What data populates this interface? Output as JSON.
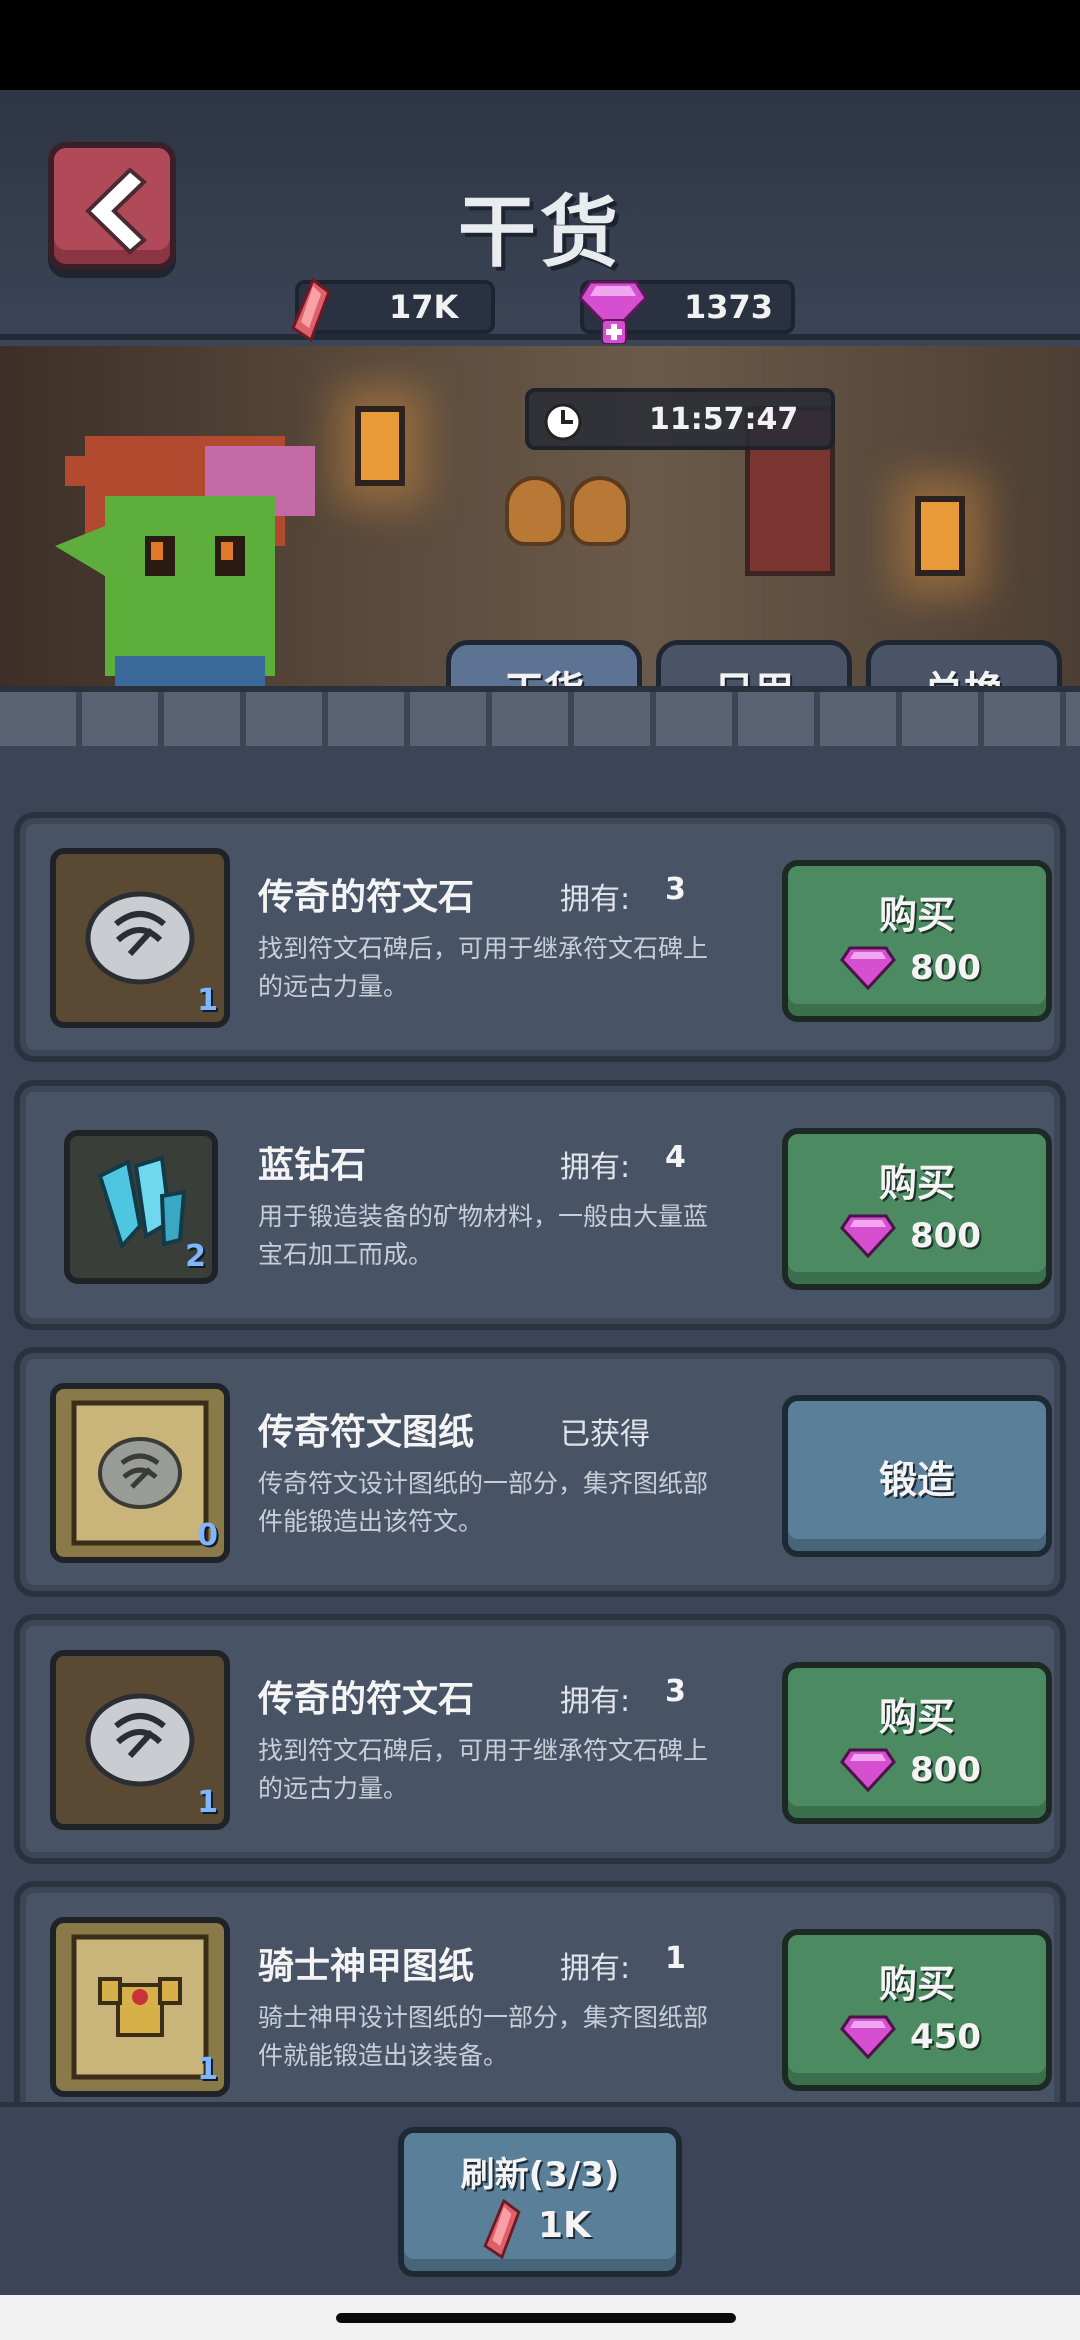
{
  "header": {
    "title": "干货",
    "currency_ruby": "17K",
    "currency_gem": "1373"
  },
  "banner": {
    "timer": "11:57:47",
    "tabs": [
      {
        "label": "干货",
        "active": true
      },
      {
        "label": "日用",
        "active": false
      },
      {
        "label": "兑换",
        "active": false
      }
    ]
  },
  "items": [
    {
      "name": "传奇的符文石",
      "own_label": "拥有:",
      "own_value": "3",
      "desc": "找到符文石碑后，可用于继承符文石碑上的远古力量。",
      "qty": "1",
      "icon": "rune-stone-icon",
      "buy_label": "购买",
      "price": "800"
    },
    {
      "name": "蓝钻石",
      "own_label": "拥有:",
      "own_value": "4",
      "desc": "用于锻造装备的矿物材料，一般由大量蓝宝石加工而成。",
      "qty": "2",
      "icon": "blue-crystal-icon",
      "buy_label": "购买",
      "price": "800"
    },
    {
      "name": "传奇符文图纸",
      "own_label": "已获得",
      "own_value": "",
      "desc": "传奇符文设计图纸的一部分，集齐图纸部件能锻造出该符文。",
      "qty": "0",
      "icon": "rune-blueprint-icon",
      "action_label": "锻造"
    },
    {
      "name": "传奇的符文石",
      "own_label": "拥有:",
      "own_value": "3",
      "desc": "找到符文石碑后，可用于继承符文石碑上的远古力量。",
      "qty": "1",
      "icon": "rune-stone-icon",
      "buy_label": "购买",
      "price": "800"
    },
    {
      "name": "骑士神甲图纸",
      "own_label": "拥有:",
      "own_value": "1",
      "desc": "骑士神甲设计图纸的一部分，集齐图纸部件就能锻造出该装备。",
      "qty": "1",
      "icon": "armor-blueprint-icon",
      "buy_label": "购买",
      "price": "450"
    }
  ],
  "refresh": {
    "label": "刷新(3/3)",
    "cost": "1K"
  },
  "colors": {
    "buy_green": "#4c8a62",
    "forge_blue": "#5a7f99",
    "panel": "#485366",
    "gem_pink": "#d64fd0",
    "ruby_red": "#e0606a"
  }
}
